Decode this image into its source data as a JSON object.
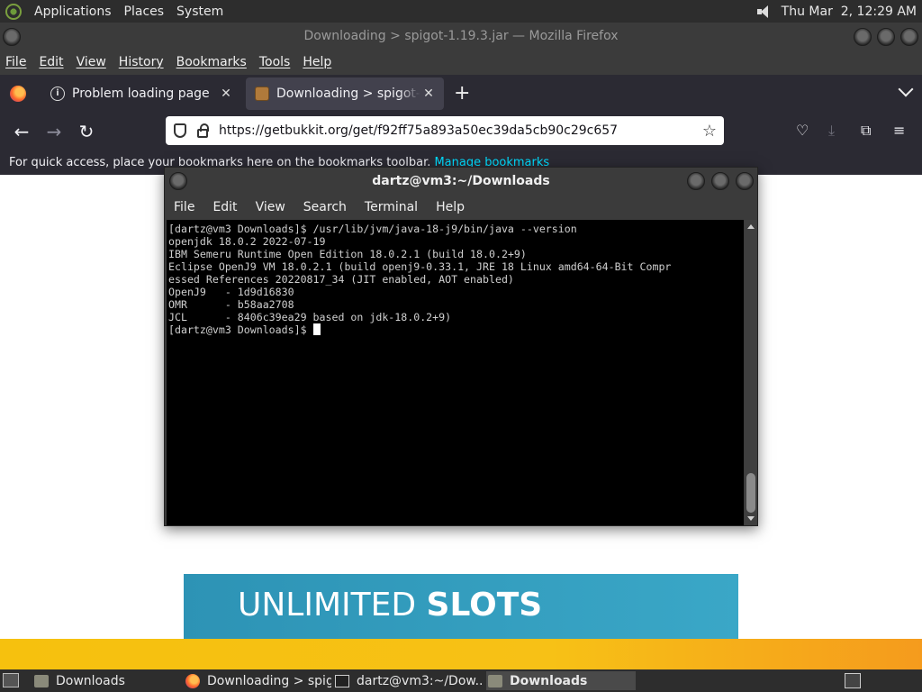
{
  "top_panel": {
    "menu": [
      "Applications",
      "Places",
      "System"
    ],
    "clock": "Thu Mar  2, 12:29 AM",
    "icons": [
      "distro-logo-icon",
      "volume-icon"
    ]
  },
  "firefox": {
    "window_title": "Downloading > spigot-1.19.3.jar — Mozilla Firefox",
    "menu": [
      "File",
      "Edit",
      "View",
      "History",
      "Bookmarks",
      "Tools",
      "Help"
    ],
    "tabs": [
      {
        "label": "Problem loading page",
        "icon": "info-icon"
      },
      {
        "label": "Downloading > spigot-1.19.3.jar",
        "icon": "spigot-icon",
        "active": true
      }
    ],
    "url": "https://getbukkit.org/get/f92ff75a893a50ec39da5cb90c29c657",
    "bookmarks_bar": {
      "text": "For quick access, place your bookmarks here on the bookmarks toolbar.",
      "link": "Manage bookmarks"
    }
  },
  "page": {
    "banner_text_light": "UNLIMITED",
    "banner_text_bold": "SLOTS"
  },
  "terminal": {
    "title": "dartz@vm3:~/Downloads",
    "menu": [
      "File",
      "Edit",
      "View",
      "Search",
      "Terminal",
      "Help"
    ],
    "lines": [
      "[dartz@vm3 Downloads]$ /usr/lib/jvm/java-18-j9/bin/java --version",
      "openjdk 18.0.2 2022-07-19",
      "IBM Semeru Runtime Open Edition 18.0.2.1 (build 18.0.2+9)",
      "Eclipse OpenJ9 VM 18.0.2.1 (build openj9-0.33.1, JRE 18 Linux amd64-64-Bit Compr",
      "essed References 20220817_34 (JIT enabled, AOT enabled)",
      "OpenJ9   - 1d9d16830",
      "OMR      - b58aa2708",
      "JCL      - 8406c39ea29 based on jdk-18.0.2+9)"
    ],
    "prompt": "[dartz@vm3 Downloads]$ "
  },
  "taskbar": {
    "items": [
      {
        "label": "Downloads",
        "icon": "folder-icon"
      },
      {
        "label": "Downloading > spig...",
        "icon": "firefox-icon"
      },
      {
        "label": "dartz@vm3:~/Dow...",
        "icon": "terminal-icon"
      },
      {
        "label": "Downloads",
        "icon": "folder-icon",
        "active": true
      }
    ]
  }
}
